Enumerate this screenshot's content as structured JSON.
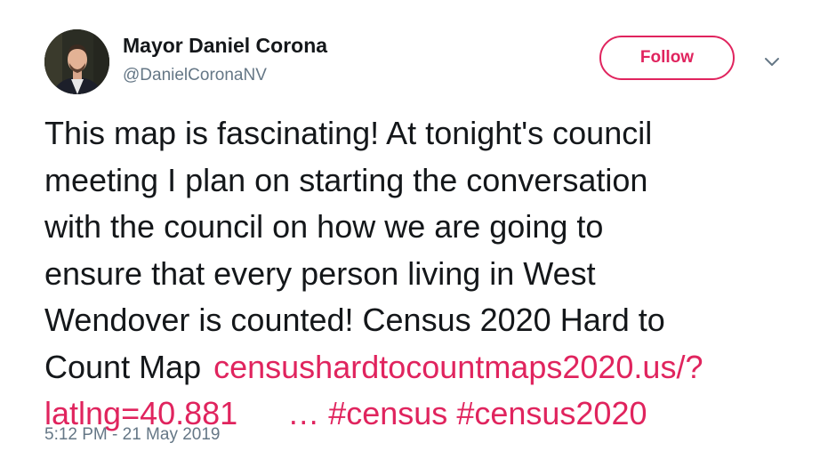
{
  "author": {
    "display_name": "Mayor Daniel Corona",
    "handle": "@DanielCoronaNV",
    "avatar_icon": "profile-photo"
  },
  "actions": {
    "follow_label": "Follow",
    "more_icon": "chevron-down-icon"
  },
  "tweet": {
    "line1": "This map is fascinating! At tonight's council",
    "line2": "meeting I plan on starting the conversation",
    "line3": "with the council on how we are going to",
    "line4": "ensure that every person living in West",
    "line5": "Wendover is counted! Census 2020 Hard to",
    "line6_text": "Count Map",
    "link_part1": "censushardtocountmaps2020.us/?",
    "link_part2": "latlng=40.881",
    "ellipsis": "…",
    "hashtag1": "#census",
    "hashtag2": "#census2020",
    "timestamp": "5:12 PM - 21 May 2019"
  },
  "colors": {
    "accent": "#e0245e",
    "text": "#14171a",
    "secondary": "#657786",
    "background": "#ffffff"
  }
}
